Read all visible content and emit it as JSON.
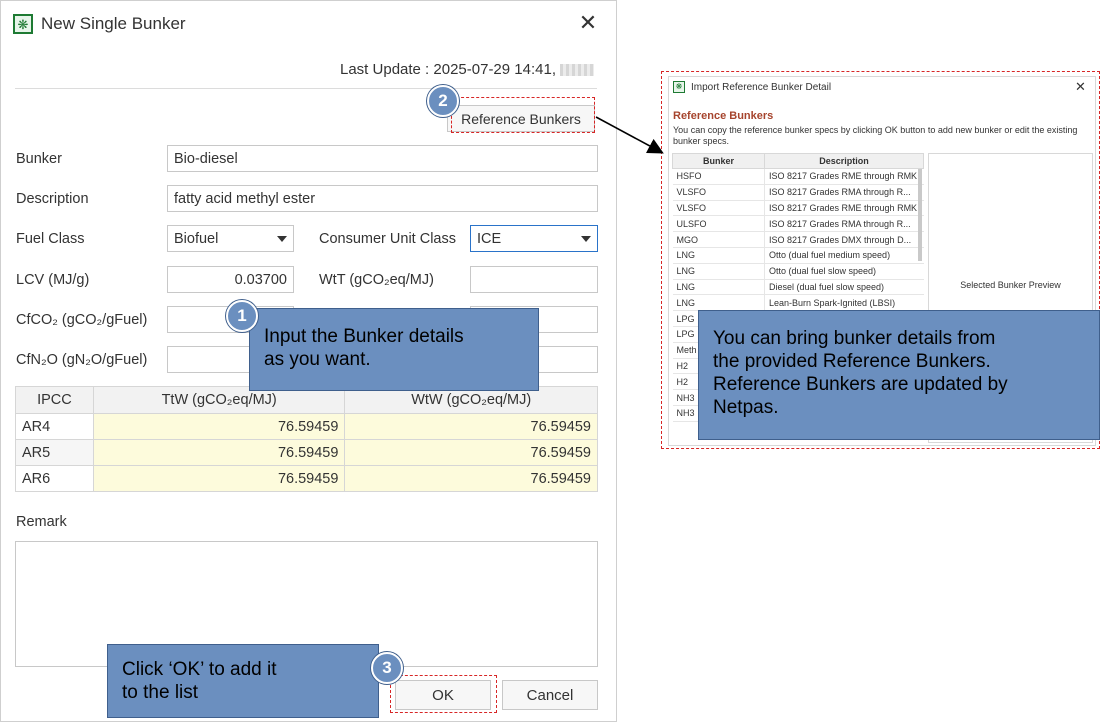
{
  "dialog": {
    "title": "New Single Bunker",
    "close_glyph": "✕",
    "last_update": "Last Update : 2025-07-29 14:41,",
    "reference_button": "Reference Bunkers"
  },
  "form": {
    "bunker_label": "Bunker",
    "bunker_value": "Bio-diesel",
    "description_label": "Description",
    "description_value": "fatty acid methyl ester",
    "fuel_class_label": "Fuel Class",
    "fuel_class_value": "Biofuel",
    "consumer_unit_label": "Consumer Unit Class",
    "consumer_unit_value": "ICE",
    "lcv_label": "LCV (MJ/g)",
    "lcv_value": "0.03700",
    "wtt_label": "WtT (gCO₂eq/MJ)",
    "wtt_value": "",
    "cfco2_label": "CfCO₂ (gCO₂/gFuel)",
    "cfco2_value": "",
    "cfch4_value": "",
    "cfn2o_label": "CfN₂O (gN₂O/gFuel)",
    "cfn2o_value": "",
    "extra_value": ""
  },
  "ipcc_table": {
    "headers": [
      "IPCC",
      "TtW (gCO₂eq/MJ)",
      "WtW (gCO₂eq/MJ)"
    ],
    "rows": [
      [
        "AR4",
        "76.59459",
        "76.59459"
      ],
      [
        "AR5",
        "76.59459",
        "76.59459"
      ],
      [
        "AR6",
        "76.59459",
        "76.59459"
      ]
    ]
  },
  "remark": {
    "label": "Remark",
    "value": ""
  },
  "buttons": {
    "ok": "OK",
    "cancel": "Cancel"
  },
  "callouts": {
    "c1": {
      "badge": "1",
      "text": [
        "Input the Bunker details",
        "as you want."
      ]
    },
    "c2": {
      "badge": "2"
    },
    "c3": {
      "badge": "3",
      "text": [
        "Click ‘OK’ to add it",
        "to the list"
      ]
    },
    "ref_note": [
      "You can bring bunker details from",
      "the provided Reference Bunkers.",
      "Reference Bunkers are updated by",
      "Netpas."
    ]
  },
  "reference_dialog": {
    "title": "Import Reference Bunker Detail",
    "section": "Reference Bunkers",
    "note": "You can copy the reference bunker specs by clicking OK button to add new bunker or edit the existing bunker specs.",
    "headers": [
      "Bunker",
      "Description"
    ],
    "rows": [
      [
        "HSFO",
        "ISO 8217 Grades RME through RMK"
      ],
      [
        "VLSFO",
        "ISO 8217 Grades RMA through R..."
      ],
      [
        "VLSFO",
        "ISO 8217 Grades RME through RMK"
      ],
      [
        "ULSFO",
        "ISO 8217 Grades RMA through R..."
      ],
      [
        "MGO",
        "ISO 8217 Grades DMX through D..."
      ],
      [
        "LNG",
        "Otto (dual fuel medium speed)"
      ],
      [
        "LNG",
        "Otto (dual fuel slow speed)"
      ],
      [
        "LNG",
        "Diesel (dual fuel slow speed)"
      ],
      [
        "LNG",
        "Lean-Burn Spark-Ignited (LBSI)"
      ],
      [
        "LPG",
        ""
      ],
      [
        "LPG",
        ""
      ],
      [
        "Meth",
        ""
      ],
      [
        "H2",
        ""
      ],
      [
        "H2",
        ""
      ],
      [
        "NH3",
        ""
      ],
      [
        "NH3",
        ""
      ]
    ],
    "preview": "Selected Bunker Preview"
  },
  "colors": {
    "callout": "#6b8fbf",
    "highlight": "#d72626",
    "brand": "#1e7a33"
  }
}
